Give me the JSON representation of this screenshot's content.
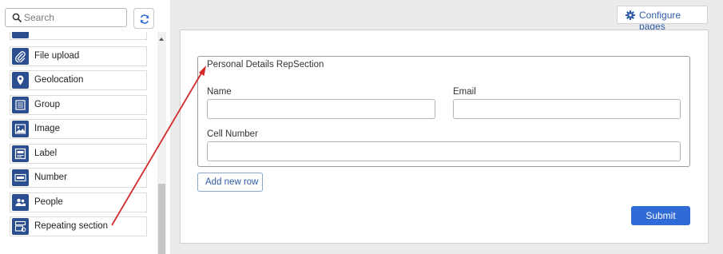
{
  "search": {
    "placeholder": "Search"
  },
  "toolbox": {
    "items": [
      {
        "label": "",
        "icon": "blank-control-icon"
      },
      {
        "label": "File upload",
        "icon": "paperclip-icon"
      },
      {
        "label": "Geolocation",
        "icon": "map-pin-icon"
      },
      {
        "label": "Group",
        "icon": "group-icon"
      },
      {
        "label": "Image",
        "icon": "image-icon"
      },
      {
        "label": "Label",
        "icon": "label-icon"
      },
      {
        "label": "Number",
        "icon": "number-icon"
      },
      {
        "label": "People",
        "icon": "people-icon"
      },
      {
        "label": "Repeating section",
        "icon": "repeating-section-icon"
      }
    ]
  },
  "header": {
    "configure_pages": "Configure pages"
  },
  "form": {
    "section_title": "Personal Details RepSection",
    "fields": {
      "name": {
        "label": "Name",
        "value": ""
      },
      "email": {
        "label": "Email",
        "value": ""
      },
      "cell": {
        "label": "Cell Number",
        "value": ""
      }
    },
    "add_row": "Add new row",
    "submit": "Submit"
  },
  "colors": {
    "accent": "#2f6ad6",
    "icon_bg": "#2a4e8f",
    "annotation_arrow": "#d42a2a",
    "link": "#2f5ca6"
  }
}
